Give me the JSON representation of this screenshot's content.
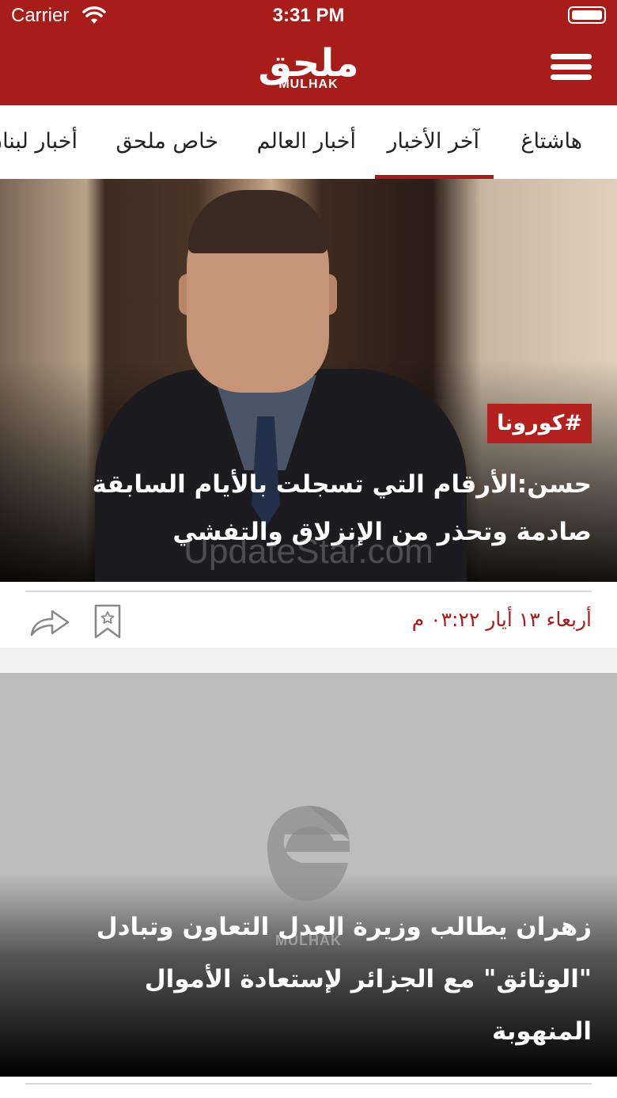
{
  "status_bar": {
    "carrier": "Carrier",
    "time": "3:31 PM"
  },
  "header": {
    "logo_ar": "ملحق",
    "logo_en": "MULHAK",
    "icons": {
      "menu": "hamburger-menu-icon"
    },
    "colors": {
      "brand": "#a81c1a"
    }
  },
  "tabs": [
    {
      "label": "هاشتاغ",
      "active": false
    },
    {
      "label": "آخر الأخبار",
      "active": true
    },
    {
      "label": "أخبار العالم",
      "active": false
    },
    {
      "label": "خاص ملحق",
      "active": false
    },
    {
      "label": "أخبار لبنان",
      "active": false
    }
  ],
  "articles": [
    {
      "tag": "#كورونا",
      "title": "حسن:الأرقام التي تسجلت بالأيام السابقة صادمة وتحذر من الإنزلاق والتفشي",
      "date": "أربعاء ١٣ أيار ٠٣:٢٢ م",
      "watermark": "UpdateStar.com",
      "icons": {
        "share": "share-arrow-icon",
        "bookmark": "bookmark-star-icon"
      }
    },
    {
      "placeholder_logo_text": "MULHAK",
      "title": "زهران يطالب وزيرة العدل التعاون  وتبادل \"الوثائق\" مع الجزائر لإستعادة الأموال المنهوبة"
    }
  ]
}
